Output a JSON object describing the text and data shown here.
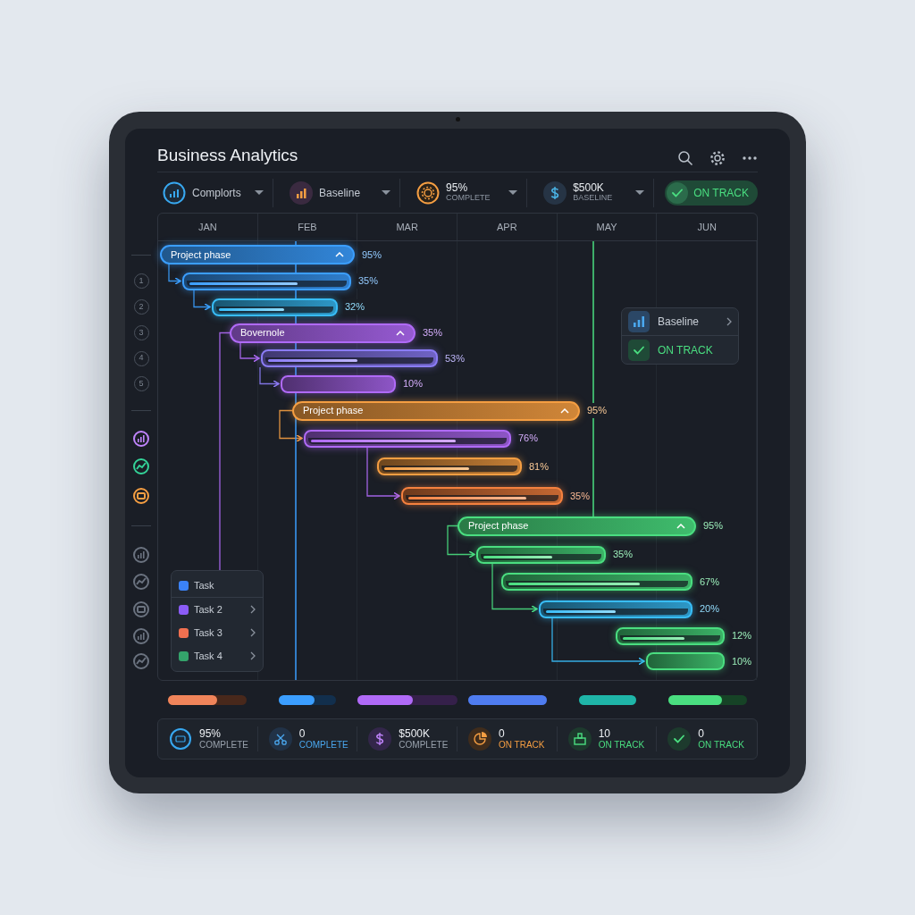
{
  "header": {
    "title": "Business Analytics"
  },
  "toolbar": [
    {
      "kind": "select",
      "label": "Complorts"
    },
    {
      "kind": "select",
      "label": "Baseline"
    },
    {
      "kind": "stat",
      "value": "95%",
      "caption": "COMPLETE"
    },
    {
      "kind": "stat",
      "value": "$500K",
      "caption": "BASELINE"
    },
    {
      "kind": "status",
      "label": "ON TRACK"
    }
  ],
  "months": [
    "JAN",
    "FEB",
    "MAR",
    "APR",
    "MAY",
    "JUN"
  ],
  "rows": [
    {
      "kind": "phase",
      "label": "Project phase",
      "percent": "95%",
      "color": "#3b9eff"
    },
    {
      "kind": "task",
      "percent": "35%",
      "color": "#3b9eff",
      "level": 0.7,
      "marker": {
        "kind": "number",
        "text": "1"
      }
    },
    {
      "kind": "task",
      "percent": "32%",
      "color": "#38bdf8",
      "level": 0.58,
      "marker": {
        "kind": "number",
        "text": "2"
      }
    },
    {
      "kind": "phase",
      "label": "Bovernole",
      "percent": "35%",
      "color": "#b06af7",
      "marker": {
        "kind": "number",
        "text": "3"
      }
    },
    {
      "kind": "task",
      "percent": "53%",
      "color": "#8b7cf6",
      "level": 0.55,
      "marker": {
        "kind": "number",
        "text": "4"
      }
    },
    {
      "kind": "task",
      "percent": "10%",
      "color": "#b06af7",
      "marker": {
        "kind": "number",
        "text": "5"
      }
    },
    {
      "kind": "phase",
      "label": "Project phase",
      "percent": "95%",
      "color": "#f59e42"
    },
    {
      "kind": "task",
      "percent": "76%",
      "color": "#b06af7",
      "level": 0.75,
      "marker": {
        "kind": "icon",
        "color": "#c084fc"
      }
    },
    {
      "kind": "task",
      "percent": "81%",
      "color": "#f59e42",
      "level": 0.65,
      "marker": {
        "kind": "icon",
        "color": "#34d399"
      }
    },
    {
      "kind": "task",
      "percent": "35%",
      "color": "#f5813f",
      "level": 0.8,
      "marker": {
        "kind": "icon",
        "color": "#f59e42"
      }
    },
    {
      "kind": "phase",
      "label": "Project phase",
      "percent": "95%",
      "color": "#4ade80"
    },
    {
      "kind": "task",
      "percent": "35%",
      "color": "#4ade80",
      "level": 0.6,
      "marker": {
        "kind": "icon",
        "color": "#6b7380"
      }
    },
    {
      "kind": "task",
      "percent": "67%",
      "color": "#4ade80",
      "level": 0.74,
      "marker": {
        "kind": "icon",
        "color": "#6b7380"
      }
    },
    {
      "kind": "task",
      "percent": "20%",
      "color": "#38bdf8",
      "level": 0.5,
      "marker": {
        "kind": "icon",
        "color": "#6b7380"
      }
    },
    {
      "kind": "task",
      "percent": "12%",
      "color": "#4ade80",
      "level": 0.65,
      "marker": {
        "kind": "icon",
        "color": "#6b7380"
      }
    },
    {
      "kind": "task",
      "percent": "10%",
      "color": "#4ade80",
      "marker": {
        "kind": "icon",
        "color": "#6b7380"
      }
    }
  ],
  "legend": [
    {
      "label": "Task",
      "color": "#3b82f6",
      "submenu": false
    },
    {
      "label": "Task 2",
      "color": "#8b5cf6",
      "submenu": true
    },
    {
      "label": "Task 3",
      "color": "#f07050",
      "submenu": true
    },
    {
      "label": "Task 4",
      "color": "#34a36b",
      "submenu": true
    }
  ],
  "popup": [
    {
      "kind": "baseline",
      "label": "Baseline"
    },
    {
      "kind": "status",
      "label": "ON TRACK"
    }
  ],
  "summary_bars": [
    {
      "level": 0.63,
      "color": "#f0845a"
    },
    {
      "level": 0.62,
      "color": "#3b9eff"
    },
    {
      "level": 0.55,
      "color": "#b06af7"
    },
    {
      "level": 1,
      "color": "#4f7cf0"
    },
    {
      "level": 1,
      "color": "#1fb5a8"
    },
    {
      "level": 0.68,
      "color": "#4ade80"
    }
  ],
  "stats": [
    {
      "value": "95%",
      "caption": "COMPLETE",
      "color": "#9aa3ae"
    },
    {
      "value": "0",
      "caption": "COMPLETE",
      "color": "#4aa8f0"
    },
    {
      "value": "$500K",
      "caption": "COMPLETE",
      "color": "#9aa3ae"
    },
    {
      "value": "0",
      "caption": "ON TRACK",
      "color": "#f59e42"
    },
    {
      "value": "10",
      "caption": "ON TRACK",
      "color": "#4ade80"
    },
    {
      "value": "0",
      "caption": "ON TRACK",
      "color": "#4ade80"
    }
  ]
}
